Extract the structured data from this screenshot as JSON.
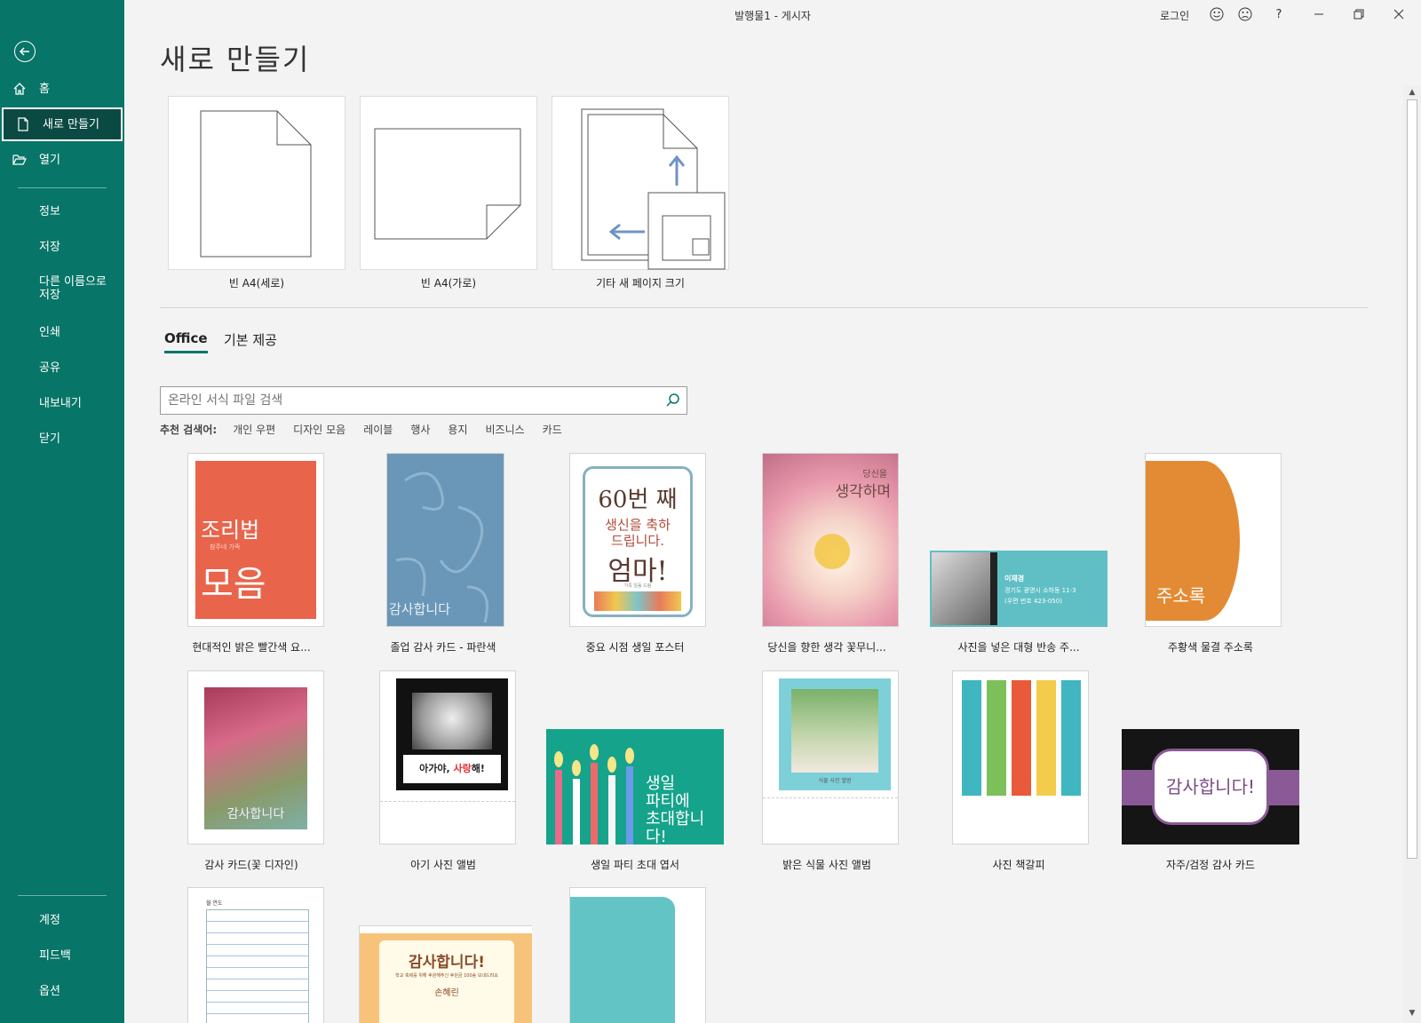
{
  "window": {
    "title": "발행물1  -  게시자",
    "login_label": "로그인"
  },
  "sidebar": {
    "items": [
      {
        "label": "홈",
        "icon": "home-icon"
      },
      {
        "label": "새로 만들기",
        "icon": "new-document-icon"
      },
      {
        "label": "열기",
        "icon": "folder-open-icon"
      },
      {
        "label": "정보"
      },
      {
        "label": "저장"
      },
      {
        "label": "다른 이름으로\n저장"
      },
      {
        "label": "인쇄"
      },
      {
        "label": "공유"
      },
      {
        "label": "내보내기"
      },
      {
        "label": "닫기"
      }
    ],
    "bottom_items": [
      {
        "label": "계정"
      },
      {
        "label": "피드백"
      },
      {
        "label": "옵션"
      }
    ]
  },
  "page_title": "새로 만들기",
  "blank_templates": [
    {
      "label": "빈 A4(세로)"
    },
    {
      "label": "빈 A4(가로)"
    },
    {
      "label": "기타 새 페이지 크기"
    }
  ],
  "tabs": [
    {
      "label": "Office",
      "active": true
    },
    {
      "label": "기본 제공",
      "active": false
    }
  ],
  "search": {
    "placeholder": "온라인 서식 파일 검색"
  },
  "suggested": {
    "heading": "추천 검색어:",
    "terms": [
      "개인 우편",
      "디자인 모음",
      "레이블",
      "행사",
      "용지",
      "비즈니스",
      "카드"
    ]
  },
  "templates": [
    {
      "caption": "현대적인 밝은 빨간색 요...",
      "texts": [
        "조리법",
        "참주네 가족",
        "모음"
      ]
    },
    {
      "caption": "졸업 감사 카드 - 파란색",
      "texts": [
        "감사합니다"
      ]
    },
    {
      "caption": "중요 시점 생일 포스터",
      "texts": [
        "60번 째",
        "생신을 축하",
        "드립니다.",
        "엄마!",
        "가족 일동 드림"
      ]
    },
    {
      "caption": "당신을 향한 생각 꽃무니...",
      "texts": [
        "당신을",
        "생각하며"
      ]
    },
    {
      "caption": "사진을 넣은 대형 반송 주...",
      "texts": [
        "이재경",
        "경기도 광명시 소하동 11-3",
        "(우편 번호 423-050)"
      ]
    },
    {
      "caption": "주황색 물결 주소록",
      "texts": [
        "주소록"
      ]
    },
    {
      "caption": "감사 카드(꽃 디자인)",
      "texts": [
        "감사합니다"
      ]
    },
    {
      "caption": "아기 사진 앨범",
      "texts": [
        "아가야, ",
        "사랑",
        "해!"
      ]
    },
    {
      "caption": "생일 파티 초대 엽서",
      "texts": [
        "생일",
        "파티에",
        "초대합니",
        "다!"
      ]
    },
    {
      "caption": "밝은 식물 사진 앨범",
      "texts": [
        "식물 사진 앨범"
      ]
    },
    {
      "caption": "사진 책갈피",
      "texts": []
    },
    {
      "caption": "자주/검정 감사 카드",
      "texts": [
        "감사합니다!"
      ]
    },
    {
      "caption": "",
      "texts": [
        "월 연도"
      ]
    },
    {
      "caption": "",
      "texts": [
        "감사합니다!",
        "학교 축제를 위해 후원해주신 후원금 100송 보내드려요",
        "손혜린"
      ]
    },
    {
      "caption": "",
      "texts": []
    }
  ],
  "colors": {
    "sidebar_bg": "#077568",
    "sidebar_active_bg": "#0b4a42",
    "accent": "#077568"
  }
}
